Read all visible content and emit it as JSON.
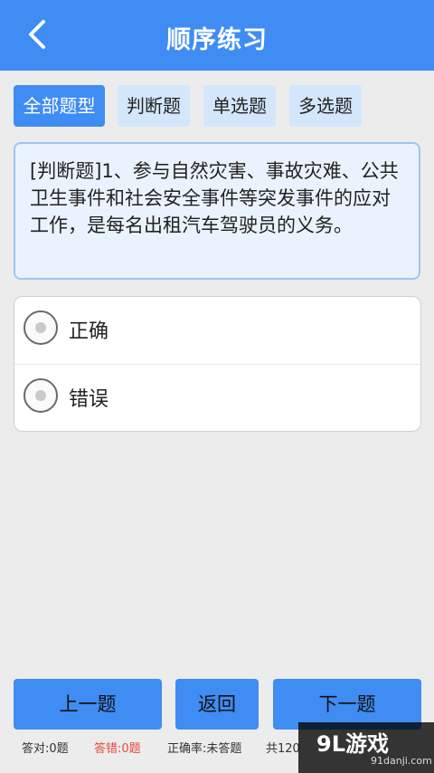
{
  "header": {
    "title": "顺序练习",
    "back_icon": "chevron-left-icon"
  },
  "tabs": [
    {
      "label": "全部题型",
      "active": true
    },
    {
      "label": "判断题",
      "active": false
    },
    {
      "label": "单选题",
      "active": false
    },
    {
      "label": "多选题",
      "active": false
    }
  ],
  "question": {
    "text": "[判断题]1、参与自然灾害、事故灾难、公共卫生事件和社会安全事件等突发事件的应对工作，是每名出租汽车驾驶员的义务。"
  },
  "options": [
    {
      "label": "正确",
      "selected": false
    },
    {
      "label": "错误",
      "selected": false
    }
  ],
  "buttons": {
    "prev": "上一题",
    "back": "返回",
    "next": "下一题"
  },
  "stats": {
    "correct": "答对:0题",
    "wrong": "答错:0题",
    "accuracy": "正确率:未答题",
    "total": "共120"
  },
  "watermark": {
    "logo": "9L游戏",
    "url": "91danji.com"
  },
  "colors": {
    "accent": "#3f8cf3",
    "wrong": "#e8463e"
  }
}
